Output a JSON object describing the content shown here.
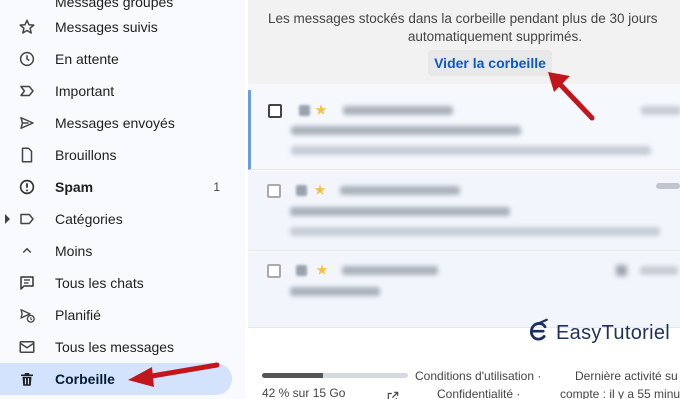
{
  "sidebar": {
    "cut_off_item": "Messages groupés",
    "items": [
      {
        "label": "Messages suivis",
        "icon": "star-icon"
      },
      {
        "label": "En attente",
        "icon": "clock-icon"
      },
      {
        "label": "Important",
        "icon": "important-icon"
      },
      {
        "label": "Messages envoyés",
        "icon": "send-icon"
      },
      {
        "label": "Brouillons",
        "icon": "draft-icon"
      },
      {
        "label": "Spam",
        "icon": "spam-icon",
        "count": "1"
      },
      {
        "label": "Catégories",
        "icon": "label-icon"
      },
      {
        "label": "Moins",
        "icon": "chevron-up-icon"
      },
      {
        "label": "Tous les chats",
        "icon": "chat-icon"
      },
      {
        "label": "Planifié",
        "icon": "scheduled-icon"
      },
      {
        "label": "Tous les messages",
        "icon": "all-mail-icon"
      },
      {
        "label": "Corbeille",
        "icon": "trash-icon"
      }
    ]
  },
  "banner": {
    "line1": "Les messages stockés dans la corbeille pendant plus de 30 jours",
    "line2": "automatiquement supprimés.",
    "empty_trash": "Vider la corbeille"
  },
  "footer": {
    "storage_label": "42 % sur 15 Go",
    "storage_fraction": 0.42,
    "terms": "Conditions d'utilisation ·",
    "privacy": "Confidentialité ·",
    "last_activity": "Dernière activité su",
    "last_activity_time": "compte : il y a 55 minu"
  },
  "watermark": {
    "text": "EasyTutoriel"
  },
  "colors": {
    "active_nav": "#d3e3fd",
    "link_blue": "#0b57d0",
    "arrow_red": "#c0161c"
  }
}
